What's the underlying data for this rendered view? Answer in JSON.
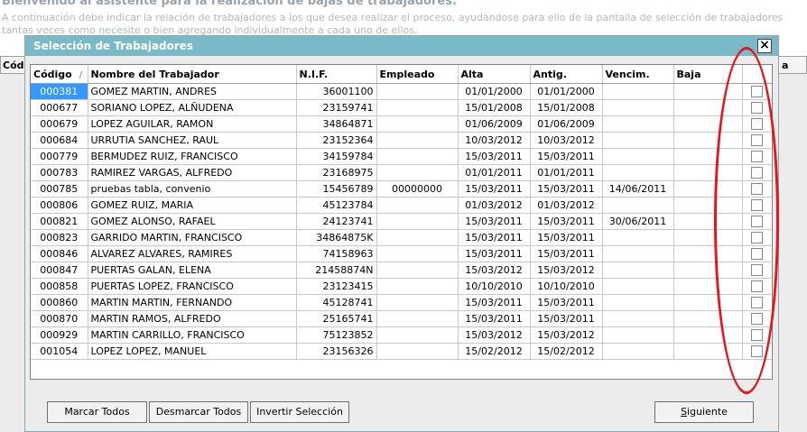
{
  "background": {
    "title": "Bienvenido al asistente para la realización de bajas de trabajadores.",
    "description": "A continuación debe indicar la relación de trabajadores a los que desea realizar el proceso, ayudándose para ello de la pantalla de selección de trabajadores tantas veces como necesite o bien agregando individualmente a cada uno de ellos.",
    "grid_left_header": "Cód",
    "grid_right_header": "a"
  },
  "dialog": {
    "title": "Selección de Trabajadores",
    "close_label": "×",
    "columns": [
      "Código",
      "Nombre del Trabajador",
      "N.I.F.",
      "Empleado",
      "Alta",
      "Antig.",
      "Vencim.",
      "Baja",
      ""
    ],
    "sort_indicator": "/",
    "rows": [
      {
        "codigo": "000381",
        "nombre": "GOMEZ MARTIN, ANDRES",
        "nif": "36001100",
        "empleado": "",
        "alta": "01/01/2000",
        "antig": "01/01/2000",
        "vencim": "",
        "baja": "",
        "checked": false,
        "selected": true
      },
      {
        "codigo": "000677",
        "nombre": "SORIANO LOPEZ, ALÑUDENA",
        "nif": "23159741",
        "empleado": "",
        "alta": "15/01/2008",
        "antig": "15/01/2008",
        "vencim": "",
        "baja": "",
        "checked": false
      },
      {
        "codigo": "000679",
        "nombre": "LOPEZ AGUILAR, RAMON",
        "nif": "34864871",
        "empleado": "",
        "alta": "01/06/2009",
        "antig": "01/06/2009",
        "vencim": "",
        "baja": "",
        "checked": false
      },
      {
        "codigo": "000684",
        "nombre": "URRUTIA SANCHEZ, RAUL",
        "nif": "23152364",
        "empleado": "",
        "alta": "10/03/2012",
        "antig": "10/03/2012",
        "vencim": "",
        "baja": "",
        "checked": false
      },
      {
        "codigo": "000779",
        "nombre": "BERMUDEZ RUIZ, FRANCISCO",
        "nif": "34159784",
        "empleado": "",
        "alta": "15/03/2011",
        "antig": "15/03/2011",
        "vencim": "",
        "baja": "",
        "checked": false
      },
      {
        "codigo": "000783",
        "nombre": "RAMIREZ VARGAS, ALFREDO",
        "nif": "23168975",
        "empleado": "",
        "alta": "01/01/2011",
        "antig": "01/01/2011",
        "vencim": "",
        "baja": "",
        "checked": false
      },
      {
        "codigo": "000785",
        "nombre": "pruebas tabla, convenio",
        "nif": "15456789",
        "empleado": "00000000",
        "alta": "15/03/2011",
        "antig": "15/03/2011",
        "vencim": "14/06/2011",
        "baja": "",
        "checked": false
      },
      {
        "codigo": "000806",
        "nombre": "GOMEZ RUIZ, MARIA",
        "nif": "45123784",
        "empleado": "",
        "alta": "01/03/2012",
        "antig": "01/03/2012",
        "vencim": "",
        "baja": "",
        "checked": false
      },
      {
        "codigo": "000821",
        "nombre": "GOMEZ ALONSO, RAFAEL",
        "nif": "24123741",
        "empleado": "",
        "alta": "15/03/2011",
        "antig": "15/03/2011",
        "vencim": "30/06/2011",
        "baja": "",
        "checked": false
      },
      {
        "codigo": "000823",
        "nombre": "GARRIDO MARTIN, FRANCISCO",
        "nif": "34864875K",
        "empleado": "",
        "alta": "15/03/2011",
        "antig": "15/03/2011",
        "vencim": "",
        "baja": "",
        "checked": false
      },
      {
        "codigo": "000846",
        "nombre": "ALVAREZ ALVARES, RAMIRES",
        "nif": "74158963",
        "empleado": "",
        "alta": "15/03/2011",
        "antig": "15/03/2011",
        "vencim": "",
        "baja": "",
        "checked": false
      },
      {
        "codigo": "000847",
        "nombre": "PUERTAS GALAN, ELENA",
        "nif": "21458874N",
        "empleado": "",
        "alta": "15/03/2012",
        "antig": "15/03/2012",
        "vencim": "",
        "baja": "",
        "checked": false
      },
      {
        "codigo": "000858",
        "nombre": "PUERTAS LOPEZ, FRANCISCO",
        "nif": "23123415",
        "empleado": "",
        "alta": "10/10/2010",
        "antig": "10/10/2010",
        "vencim": "",
        "baja": "",
        "checked": false
      },
      {
        "codigo": "000860",
        "nombre": "MARTIN MARTIN, FERNANDO",
        "nif": "45128741",
        "empleado": "",
        "alta": "15/03/2011",
        "antig": "15/03/2011",
        "vencim": "",
        "baja": "",
        "checked": false
      },
      {
        "codigo": "000870",
        "nombre": "MARTIN RAMOS, ALFREDO",
        "nif": "25165741",
        "empleado": "",
        "alta": "15/03/2011",
        "antig": "15/03/2011",
        "vencim": "",
        "baja": "",
        "checked": false
      },
      {
        "codigo": "000929",
        "nombre": "MARTIN CARRILLO, FRANCISCO",
        "nif": "75123852",
        "empleado": "",
        "alta": "15/03/2012",
        "antig": "15/03/2012",
        "vencim": "",
        "baja": "",
        "checked": false
      },
      {
        "codigo": "001054",
        "nombre": "LOPEZ LOPEZ, MANUEL",
        "nif": "23156326",
        "empleado": "",
        "alta": "15/02/2012",
        "antig": "15/02/2012",
        "vencim": "",
        "baja": "",
        "checked": false
      }
    ],
    "buttons": {
      "marcar_todos": "Marcar Todos",
      "desmarcar_todos": "Desmarcar Todos",
      "invertir_seleccion": "Invertir Selección",
      "siguiente_first": "S",
      "siguiente_rest": "iguiente"
    }
  },
  "colors": {
    "title_bar": "#79b9c8",
    "selected_cell": "#3399ff",
    "annotation": "#e8131b"
  },
  "icons": [
    "close-icon",
    "sort-icon",
    "checkbox-icon"
  ]
}
